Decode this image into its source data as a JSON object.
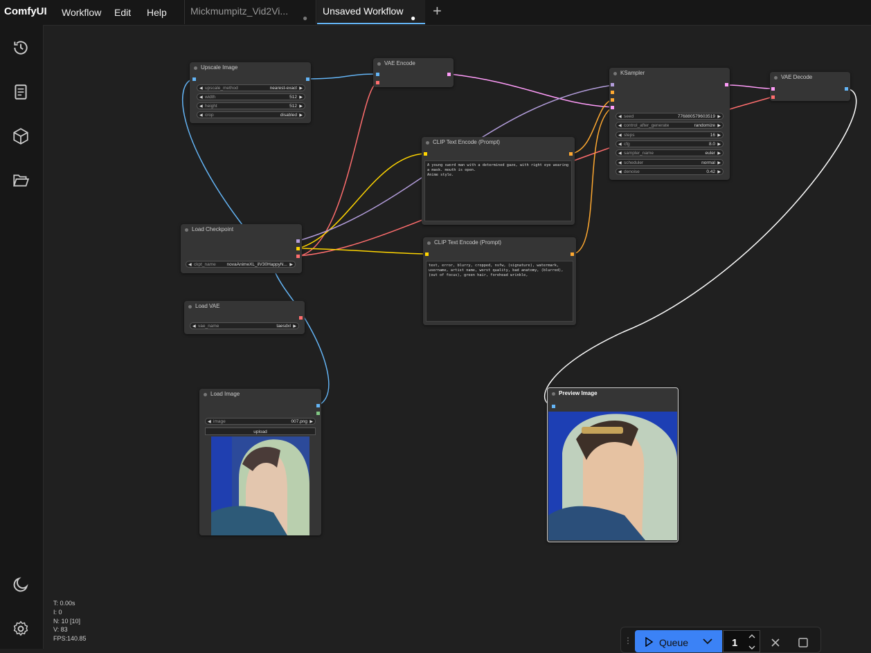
{
  "app": {
    "brand": "ComfyUI",
    "menus": [
      "Workflow",
      "Edit",
      "Help"
    ]
  },
  "tabs": [
    {
      "label": "Mickmumpitz_Vid2Vi...",
      "active": false
    },
    {
      "label": "Unsaved Workflow",
      "active": true
    }
  ],
  "sidebar_icons": [
    "history-icon",
    "book-icon",
    "cube-icon",
    "folder-open-icon",
    "moon-icon",
    "gear-icon"
  ],
  "nodes": {
    "upscale": {
      "title": "Upscale Image",
      "widgets": [
        {
          "label": "upscale_method",
          "value": "nearest-exact"
        },
        {
          "label": "width",
          "value": "512"
        },
        {
          "label": "height",
          "value": "512"
        },
        {
          "label": "crop",
          "value": "disabled"
        }
      ]
    },
    "vae_encode": {
      "title": "VAE Encode"
    },
    "ksampler": {
      "title": "KSampler",
      "widgets": [
        {
          "label": "seed",
          "value": "776880579603519"
        },
        {
          "label": "control_after_generate",
          "value": "randomize"
        },
        {
          "label": "steps",
          "value": "16"
        },
        {
          "label": "cfg",
          "value": "8.0"
        },
        {
          "label": "sampler_name",
          "value": "euler"
        },
        {
          "label": "scheduler",
          "value": "normal"
        },
        {
          "label": "denoise",
          "value": "0.42"
        }
      ]
    },
    "vae_decode": {
      "title": "VAE Decode"
    },
    "clip_pos": {
      "title": "CLIP Text Encode (Prompt)",
      "text": "A young sword man with a determined gaze, with right eye wearing a mask. mouth is open.\nAnime style."
    },
    "clip_neg": {
      "title": "CLIP Text Encode (Prompt)",
      "text": "text, error, blurry, cropped, nsfw, (signature), watermark, username, artist name, worst quality, bad anatomy, (blurred), (out of focus), green hair, forehead wrinkle,"
    },
    "checkpoint": {
      "title": "Load Checkpoint",
      "widgets": [
        {
          "label": "ckpt_name",
          "value": "novaAnimeXL_ilV30HappyN..."
        }
      ]
    },
    "load_vae": {
      "title": "Load VAE",
      "widgets": [
        {
          "label": "vae_name",
          "value": "taesdxl"
        }
      ]
    },
    "load_image": {
      "title": "Load Image",
      "widgets": [
        {
          "label": "image",
          "value": "007.png"
        }
      ],
      "upload": "upload"
    },
    "preview": {
      "title": "Preview Image"
    }
  },
  "stats": {
    "t": "T: 0.00s",
    "i": "I: 0",
    "n": "N: 10 [10]",
    "v": "V: 83",
    "fps": "FPS:140.85"
  },
  "queue": {
    "label": "Queue",
    "count": "1"
  },
  "colors": {
    "latent": "#ff9cf9",
    "image": "#64b5f6",
    "vae": "#ff6e6e",
    "conditioning": "#ffd500",
    "clip": "#ffd500",
    "model": "#b39ddb"
  }
}
